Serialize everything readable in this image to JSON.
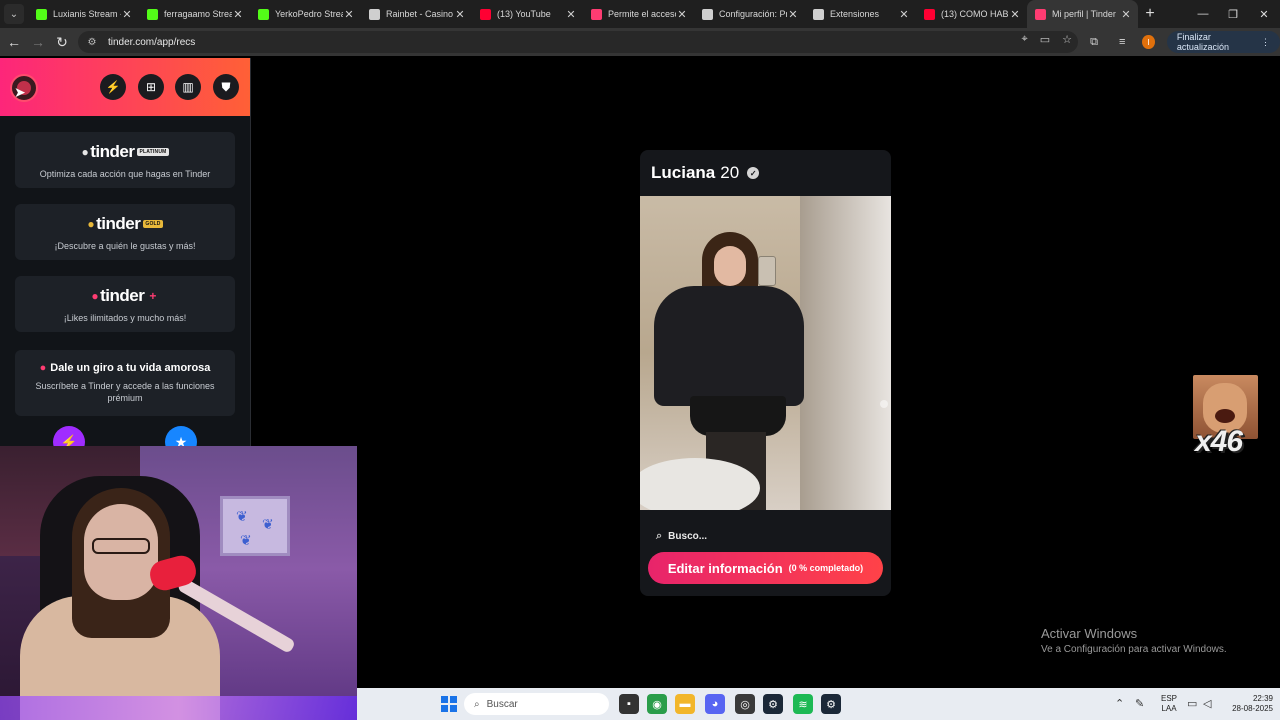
{
  "browser": {
    "tabs": [
      {
        "label": "Luxianis Stream -",
        "icon": "kick-icon",
        "color": "#53fc18",
        "active": false
      },
      {
        "label": "ferragaamo Strea",
        "icon": "kick-icon",
        "color": "#53fc18",
        "active": false
      },
      {
        "label": "YerkoPedro Strea",
        "icon": "kick-icon",
        "color": "#53fc18",
        "active": false
      },
      {
        "label": "Rainbet - Casino y",
        "icon": "rainbet-icon",
        "color": "#cfcfcf",
        "active": false
      },
      {
        "label": "(13) YouTube",
        "icon": "youtube-icon",
        "color": "#ff0033",
        "active": false
      },
      {
        "label": "Permite el acceso",
        "icon": "tinder-icon",
        "color": "#fe3c72",
        "active": false
      },
      {
        "label": "Configuración: Pr",
        "icon": "gear-icon",
        "color": "#cfcfcf",
        "active": false
      },
      {
        "label": "Extensiones",
        "icon": "puzzle-icon",
        "color": "#cfcfcf",
        "active": false
      },
      {
        "label": "(13) COMO HABL",
        "icon": "youtube-icon",
        "color": "#ff0033",
        "active": false
      },
      {
        "label": "Mi perfil | Tinder",
        "icon": "tinder-icon",
        "color": "#fe3c72",
        "active": true
      }
    ],
    "url": "tinder.com/app/recs",
    "profile_initial": "I",
    "update_label": "Finalizar actualización"
  },
  "sidebar": {
    "promos": [
      {
        "logo": "tinder",
        "tier": "PLATINUM",
        "tier_color": "#e5e5e5",
        "text": "Optimiza cada acción que hagas en Tinder"
      },
      {
        "logo": "tinder",
        "tier": "GOLD",
        "tier_color": "#e8b83a",
        "text": "¡Descubre a quién le gustas y más!"
      },
      {
        "logo": "tinder",
        "tier": "+",
        "tier_color": "#fe3c72",
        "text": "¡Likes ilimitados y mucho más!"
      }
    ],
    "subscribe": {
      "title": "Dale un giro a tu vida amorosa",
      "text": "Suscríbete a Tinder y accede a las funciones prémium"
    }
  },
  "profile": {
    "name": "Luciana",
    "age": "20",
    "seek_label": "Busco...",
    "edit_label": "Editar información",
    "edit_progress": "(0 % completado)"
  },
  "emote": {
    "count": "x46"
  },
  "watermark": {
    "title": "Activar Windows",
    "subtitle": "Ve a Configuración para activar Windows."
  },
  "taskbar": {
    "search_placeholder": "Buscar",
    "lang_top": "ESP",
    "lang_bottom": "LAA",
    "time": "22:39",
    "date": "28-08-2025"
  },
  "colors": {
    "tinder_gradient_start": "#fd267a",
    "tinder_gradient_end": "#ff6036",
    "button_gradient_start": "#e8246b",
    "button_gradient_end": "#ff4248"
  }
}
